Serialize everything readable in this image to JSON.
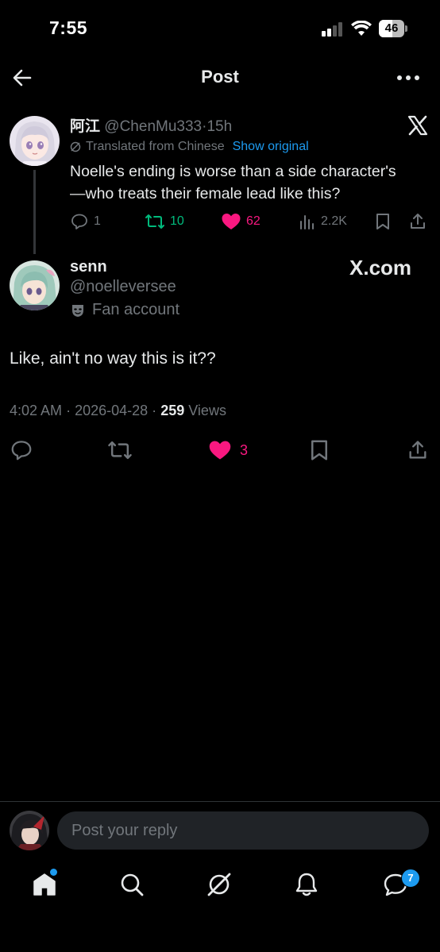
{
  "status_bar": {
    "time": "7:55",
    "battery": "46",
    "icons": [
      "signal-icon",
      "wifi-icon",
      "battery-icon"
    ]
  },
  "header": {
    "title": "Post",
    "icons": [
      "back-arrow-icon",
      "more-icon"
    ]
  },
  "parent_post": {
    "name": "阿江",
    "handle": "@ChenMu333",
    "separator": "·",
    "time": "15h",
    "translated_label": "Translated from Chinese",
    "show_original": "Show original",
    "text": "Noelle's ending is worse than a side character's\n—who treats their female lead like this?",
    "replies": "1",
    "reposts": "10",
    "likes": "62",
    "views": "2.2K",
    "colors": {
      "repost": "#00ba7c",
      "like": "#f91880"
    }
  },
  "main_post": {
    "name": "senn",
    "handle": "@noelleversee",
    "label": "Fan account",
    "watermark": "X.com",
    "text": "Like, ain't no way this is it??",
    "time": "4:02 AM",
    "sep1": "·",
    "date": "2026-04-28",
    "sep2": "·",
    "views_count": "259",
    "views_label": "Views",
    "likes": "3"
  },
  "reply_bar": {
    "placeholder": "Post your reply"
  },
  "bottom_nav": {
    "items": [
      "home-icon",
      "search-icon",
      "grok-icon",
      "notifications-icon",
      "messages-icon"
    ],
    "messages_badge": "7"
  },
  "colors": {
    "accent": "#1d9bf0",
    "muted": "#71767b",
    "text": "#e7e9ea",
    "like": "#f91880",
    "repost": "#00ba7c"
  }
}
